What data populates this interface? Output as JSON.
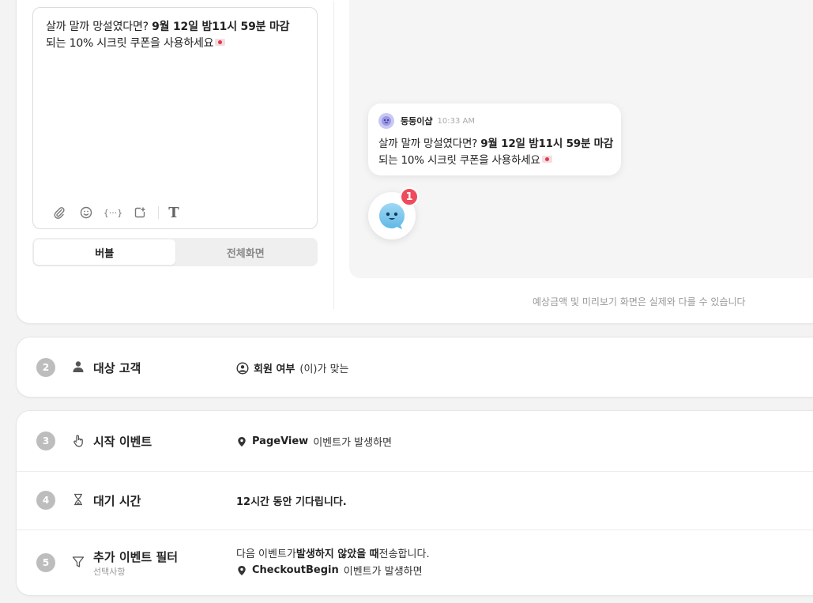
{
  "editor": {
    "message_part1": "살까 말까 망설였다면? ",
    "message_bold": "9월 12일 밤11시 59분 마감",
    "message_part2": "되는 10% 시크릿 쿠폰을 사용하세요",
    "toolbar_icons": [
      "paperclip-icon",
      "smiley-icon",
      "variable-icon",
      "image-add-icon",
      "text-format-icon"
    ],
    "variable_label": "{···}",
    "text_format_label": "T"
  },
  "view_toggle": {
    "bubble_label": "버블",
    "fullscreen_label": "전체화면",
    "selected": "버블"
  },
  "preview": {
    "bot_name": "둥둥이샵",
    "time": "10:33 AM",
    "message_part1": "살까 말까 망설였다면? ",
    "message_bold": "9월 12일 밤11시 59분 마감",
    "message_part2": "되는 10% 시크릿 쿠폰을 사용하세요",
    "badge_count": "1",
    "note": "예상금액 및 미리보기 화면은 실제와 다를 수 있습니다"
  },
  "steps": {
    "target": {
      "number": "2",
      "title": "대상 고객",
      "desc_bold": "회원 여부",
      "desc_rest": "(이)가 맞는"
    },
    "start_event": {
      "number": "3",
      "title": "시작 이벤트",
      "desc_bold": "PageView",
      "desc_rest": "이벤트가 발생하면"
    },
    "wait": {
      "number": "4",
      "title": "대기 시간",
      "desc_bold": "12시간 동안 기다립니다."
    },
    "filter": {
      "number": "5",
      "title": "추가 이벤트 필터",
      "subtitle": "선택사항",
      "line1_pre": "다음 이벤트가 ",
      "line1_bold": "발생하지 않았을 때",
      "line1_post": " 전송합니다.",
      "line2_bold": "CheckoutBegin",
      "line2_rest": "이벤트가 발생하면"
    }
  },
  "colors": {
    "badge": "#ef4b5c",
    "step_number": "#bdbdbd",
    "preview_bg": "#f5f5f5"
  }
}
